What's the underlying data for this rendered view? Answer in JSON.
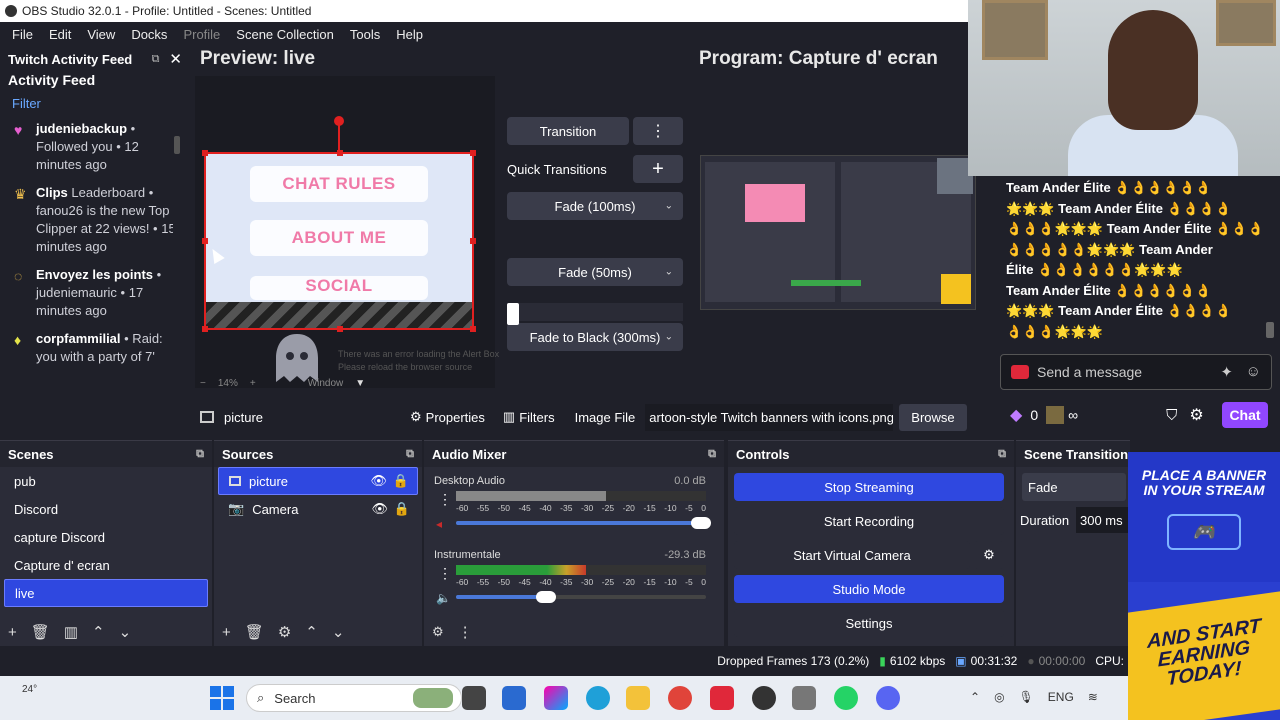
{
  "window_title": "OBS Studio 32.0.1 - Profile: Untitled - Scenes: Untitled",
  "menu": [
    "File",
    "Edit",
    "View",
    "Docks",
    "Profile",
    "Scene Collection",
    "Tools",
    "Help"
  ],
  "feed": {
    "dock_title": "Twitch Activity Feed",
    "title": "Activity Feed",
    "filter": "Filter",
    "items": [
      {
        "user": "judeniebackup",
        "text": " • Followed you • 12 minutes ago",
        "icon": "heart-icon"
      },
      {
        "user": "Clips",
        "text": " Leaderboard • fanou26 is the new Top Clipper at 22 views! • 15 minutes ago",
        "icon": "crown-icon"
      },
      {
        "user": "Envoyez les points",
        "text": " • judeniemauric • 17 minutes ago",
        "icon": "points-icon"
      },
      {
        "user": "corpfammilial",
        "text": " • Raid: you with a party of 7'",
        "icon": "raid-icon"
      }
    ]
  },
  "preview": {
    "title": "Preview: live",
    "banners": [
      "CHAT RULES",
      "ABOUT ME",
      "SOCIAL"
    ],
    "error_line1": "There was an error loading the Alert Box",
    "error_line2": "Please reload the browser source",
    "zoom": "14%",
    "source_label": "Window"
  },
  "program": {
    "title": "Program: Capture d' ecran"
  },
  "transitions": {
    "transition_label": "Transition",
    "quick_label": "Quick Transitions",
    "items": [
      "Fade (100ms)",
      "Fade (50ms)",
      "Fade to Black (300ms)"
    ]
  },
  "chat": {
    "lines": [
      "Team Ander Élite 👌👌👌👌👌👌",
      "🌟🌟🌟 Team Ander Élite 👌👌👌👌",
      "👌👌👌🌟🌟🌟 Team Ander Élite 👌👌👌",
      "👌👌👌👌👌🌟🌟🌟 Team Ander",
      "Élite 👌👌👌👌👌👌🌟🌟🌟",
      "Team Ander Élite 👌👌👌👌👌👌",
      "🌟🌟🌟 Team Ander Élite 👌👌👌👌",
      "👌👌👌🌟🌟🌟"
    ],
    "placeholder": "Send a message",
    "points": "0",
    "infinity": "∞",
    "chat_button": "Chat"
  },
  "source_bar": {
    "name": "picture",
    "properties": "Properties",
    "filters": "Filters",
    "type": "Image File",
    "file": "artoon-style Twitch banners with icons.png",
    "browse": "Browse"
  },
  "scenes": {
    "title": "Scenes",
    "items": [
      "pub",
      "Discord",
      "capture Discord",
      "Capture d' ecran",
      "live"
    ],
    "selected": "live"
  },
  "sources": {
    "title": "Sources",
    "items": [
      "picture",
      "Camera"
    ]
  },
  "mixer": {
    "title": "Audio Mixer",
    "channels": [
      {
        "name": "Desktop Audio",
        "db": "0.0 dB",
        "level": 0.6,
        "volume": 0.98
      },
      {
        "name": "Instrumentale",
        "db": "-29.3 dB",
        "level": 0.52,
        "volume": 0.36
      }
    ],
    "scale": [
      "-60",
      "-55",
      "-50",
      "-45",
      "-40",
      "-35",
      "-30",
      "-25",
      "-20",
      "-15",
      "-10",
      "-5",
      "0"
    ]
  },
  "controls": {
    "title": "Controls",
    "stop_streaming": "Stop Streaming",
    "start_recording": "Start Recording",
    "start_virtual_camera": "Start Virtual Camera",
    "studio_mode": "Studio Mode",
    "settings": "Settings"
  },
  "scene_transitions": {
    "title": "Scene Transitions",
    "selected": "Fade",
    "duration_label": "Duration",
    "duration": "300 ms"
  },
  "status": {
    "dropped": "Dropped Frames 173 (0.2%)",
    "kbps": "6102 kbps",
    "stream_time": "00:31:32",
    "rec_time": "00:00:00",
    "cpu": "CPU:"
  },
  "taskbar": {
    "weather": "24°",
    "search": "Search",
    "lang": "ENG"
  },
  "ad": {
    "top_line1": "PLACE A BANNER",
    "top_line2": "IN YOUR STREAM",
    "bottom_line1": "AND START",
    "bottom_line2": "EARNING",
    "bottom_line3": "TODAY!"
  },
  "colors": {
    "accent": "#2f48e0",
    "twitch_purple": "#9147ff",
    "record_red": "#e02020"
  }
}
